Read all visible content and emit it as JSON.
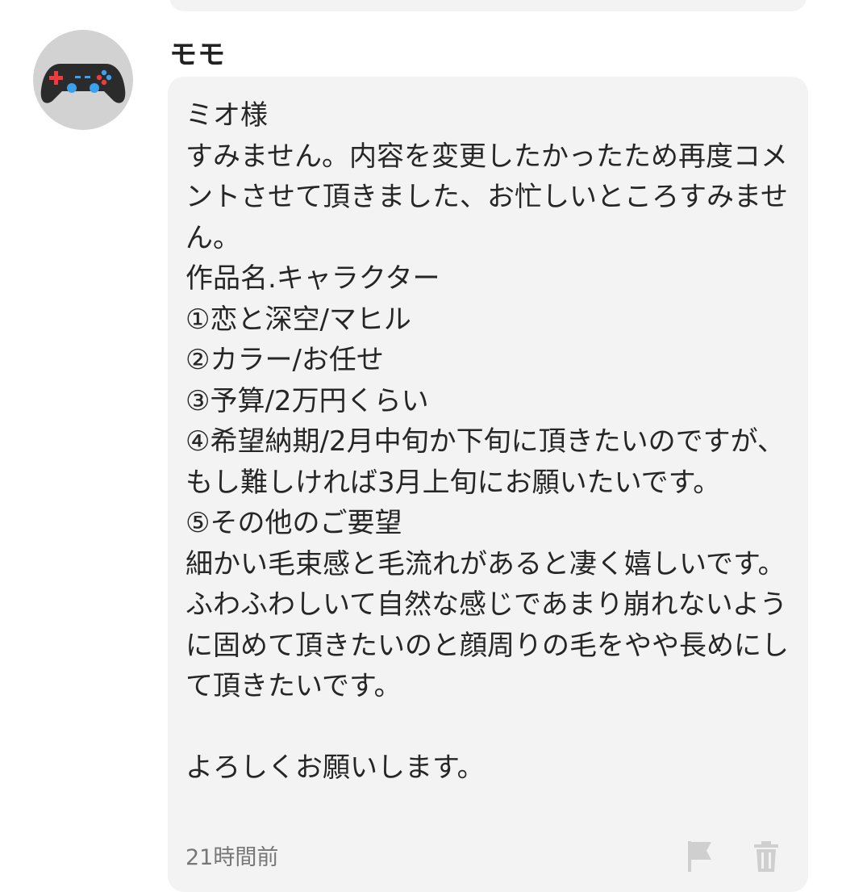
{
  "comment": {
    "username": "モモ",
    "avatar_icon": "gamepad-icon",
    "message": "ミオ様\nすみません。内容を変更したかったため再度コメントさせて頂きました、お忙しいところすみません。\n作品名.キャラクター\n①恋と深空/マヒル\n②カラー/お任せ\n③予算/2万円くらい\n④希望納期/2月中旬か下旬に頂きたいのですが、もし難しければ3月上旬にお願いたいです。\n⑤その他のご要望\n細かい毛束感と毛流れがあると凄く嬉しいです。ふわふわしいて自然な感じであまり崩れないように固めて頂きたいのと顔周りの毛をやや長めにして頂きたいです。\n\nよろしくお願いします。",
    "timestamp": "21時間前",
    "actions": {
      "report_icon": "flag-icon",
      "delete_icon": "trash-icon"
    }
  },
  "colors": {
    "bubble_bg": "#f3f3f3",
    "avatar_bg": "#d2d2d2",
    "icon_gray": "#cfcfcf"
  }
}
